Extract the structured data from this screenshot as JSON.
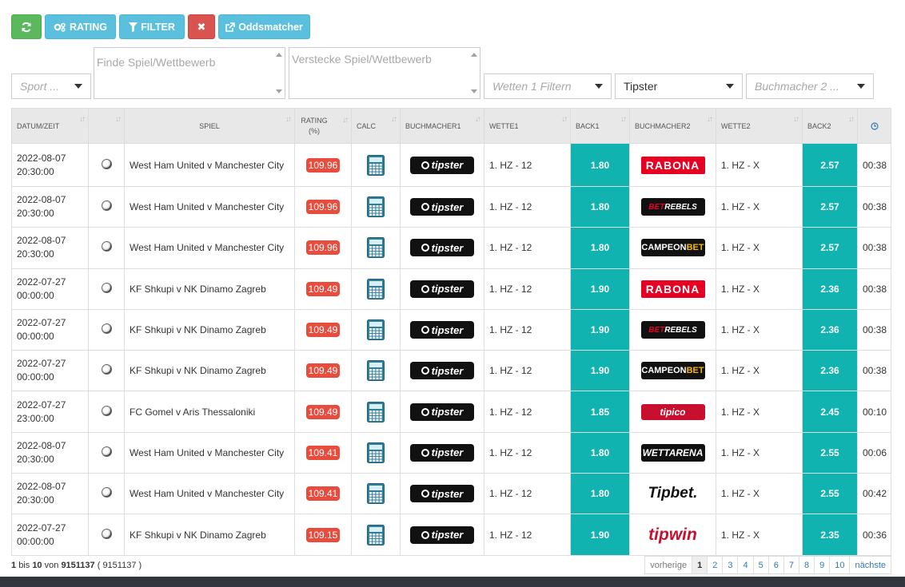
{
  "toolbar": {
    "rating_label": "RATING",
    "filter_label": "FILTER",
    "close_label": "✖",
    "oddsmatcher_label": "Oddsmatcher"
  },
  "filters": {
    "sport_placeholder": "Sport ...",
    "search_placeholder": "Finde Spiel/Wettbewerb",
    "hide_placeholder": "Verstecke Spiel/Wettbewerb",
    "wetten_placeholder": "Wetten 1 Filtern",
    "bookmaker1_value": "Tipster",
    "bookmaker2_placeholder": "Buchmacher 2 ..."
  },
  "table": {
    "headers": {
      "date": "DATUM/ZEIT",
      "spiel": "SPIEL",
      "rating": "RATING (%)",
      "calc": "CALC",
      "buchmacher1": "BUCHMACHER1",
      "wette1": "WETTE1",
      "back1": "BACK1",
      "buchmacher2": "BUCHMACHER2",
      "wette2": "WETTE2",
      "back2": "BACK2"
    },
    "rows": [
      {
        "date": "2022-08-07",
        "time": "20:30:00",
        "spiel": "West Ham United v Manchester City",
        "rating": "109.96",
        "bm1": "tipster",
        "wette1": "1. HZ - 12",
        "back1": "1.80",
        "bm2": "rabona",
        "wette2": "1. HZ - X",
        "back2": "2.57",
        "ago": "00:38"
      },
      {
        "date": "2022-08-07",
        "time": "20:30:00",
        "spiel": "West Ham United v Manchester City",
        "rating": "109.96",
        "bm1": "tipster",
        "wette1": "1. HZ - 12",
        "back1": "1.80",
        "bm2": "betrebels",
        "wette2": "1. HZ - X",
        "back2": "2.57",
        "ago": "00:38"
      },
      {
        "date": "2022-08-07",
        "time": "20:30:00",
        "spiel": "West Ham United v Manchester City",
        "rating": "109.96",
        "bm1": "tipster",
        "wette1": "1. HZ - 12",
        "back1": "1.80",
        "bm2": "campeonbet",
        "wette2": "1. HZ - X",
        "back2": "2.57",
        "ago": "00:38"
      },
      {
        "date": "2022-07-27",
        "time": "00:00:00",
        "spiel": "KF Shkupi v NK Dinamo Zagreb",
        "rating": "109.49",
        "bm1": "tipster",
        "wette1": "1. HZ - 12",
        "back1": "1.90",
        "bm2": "rabona",
        "wette2": "1. HZ - X",
        "back2": "2.36",
        "ago": "00:38"
      },
      {
        "date": "2022-07-27",
        "time": "00:00:00",
        "spiel": "KF Shkupi v NK Dinamo Zagreb",
        "rating": "109.49",
        "bm1": "tipster",
        "wette1": "1. HZ - 12",
        "back1": "1.90",
        "bm2": "betrebels",
        "wette2": "1. HZ - X",
        "back2": "2.36",
        "ago": "00:38"
      },
      {
        "date": "2022-07-27",
        "time": "00:00:00",
        "spiel": "KF Shkupi v NK Dinamo Zagreb",
        "rating": "109.49",
        "bm1": "tipster",
        "wette1": "1. HZ - 12",
        "back1": "1.90",
        "bm2": "campeonbet",
        "wette2": "1. HZ - X",
        "back2": "2.36",
        "ago": "00:38"
      },
      {
        "date": "2022-07-27",
        "time": "23:00:00",
        "spiel": "FC Gomel v Aris Thessaloniki",
        "rating": "109.49",
        "bm1": "tipster",
        "wette1": "1. HZ - 12",
        "back1": "1.85",
        "bm2": "tipico",
        "wette2": "1. HZ - X",
        "back2": "2.45",
        "ago": "00:10"
      },
      {
        "date": "2022-08-07",
        "time": "20:30:00",
        "spiel": "West Ham United v Manchester City",
        "rating": "109.41",
        "bm1": "tipster",
        "wette1": "1. HZ - 12",
        "back1": "1.80",
        "bm2": "wettarena",
        "wette2": "1. HZ - X",
        "back2": "2.55",
        "ago": "00:06"
      },
      {
        "date": "2022-08-07",
        "time": "20:30:00",
        "spiel": "West Ham United v Manchester City",
        "rating": "109.41",
        "bm1": "tipster",
        "wette1": "1. HZ - 12",
        "back1": "1.80",
        "bm2": "tipbet",
        "wette2": "1. HZ - X",
        "back2": "2.55",
        "ago": "00:42"
      },
      {
        "date": "2022-07-27",
        "time": "00:00:00",
        "spiel": "KF Shkupi v NK Dinamo Zagreb",
        "rating": "109.15",
        "bm1": "tipster",
        "wette1": "1. HZ - 12",
        "back1": "1.90",
        "bm2": "tipwin",
        "wette2": "1. HZ - X",
        "back2": "2.35",
        "ago": "00:36"
      }
    ]
  },
  "logos": {
    "tipster": "tipster",
    "rabona": "RABONA",
    "betrebels_bet": "BET",
    "betrebels_rebels": "REBELS",
    "campeon": "CAMPEON",
    "campeon_bet": "BET",
    "tipico": "tipico",
    "wettarena": "WETTARENA",
    "tipbet": "Tipbet.",
    "tipwin": "tipwin"
  },
  "footer": {
    "from": "1",
    "bis": "bis",
    "to": "10",
    "von": "von",
    "total": "9151137",
    "total_paren": "( 9151137 )"
  },
  "pagination": {
    "prev": "vorherige",
    "pages": [
      "1",
      "2",
      "3",
      "4",
      "5",
      "6",
      "7",
      "8",
      "9",
      "10"
    ],
    "next": "nächste",
    "current": "1"
  },
  "colors": {
    "back_cell": "#10b3b0",
    "rating_badge": "#e84c3d",
    "btn_green": "#5cb85c",
    "btn_info": "#5bc0de",
    "btn_red": "#d9534f"
  }
}
